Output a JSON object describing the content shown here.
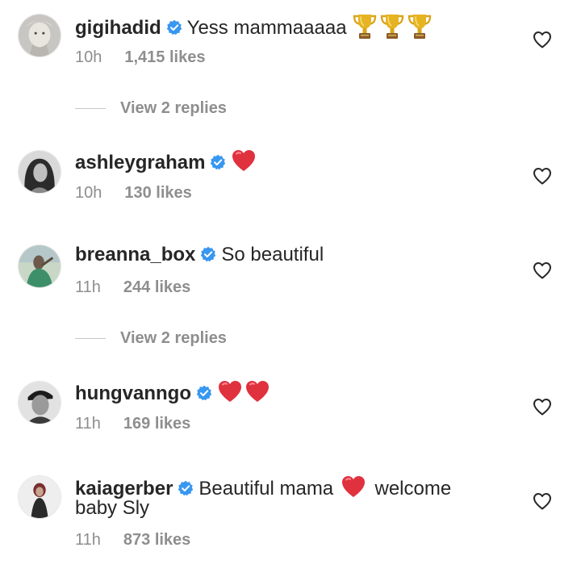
{
  "colors": {
    "text": "#262626",
    "muted": "#8e8e8e",
    "verified": "#3897f0",
    "heart_red": "#ed4956"
  },
  "comments": [
    {
      "username": "gigihadid",
      "verified": true,
      "text": "Yess mammaaaaa",
      "emojis": [
        "trophy",
        "trophy",
        "trophy"
      ],
      "time": "10h",
      "likes": "1,415 likes",
      "replies_label": "View 2 replies"
    },
    {
      "username": "ashleygraham",
      "verified": true,
      "text": "",
      "emojis": [
        "red-heart"
      ],
      "time": "10h",
      "likes": "130 likes"
    },
    {
      "username": "breanna_box",
      "verified": true,
      "text": "So beautiful",
      "time": "11h",
      "likes": "244 likes",
      "replies_label": "View 2 replies"
    },
    {
      "username": "hungvanngo",
      "verified": true,
      "text": "",
      "emojis": [
        "red-heart",
        "red-heart"
      ],
      "time": "11h",
      "likes": "169 likes"
    },
    {
      "username": "kaiagerber",
      "verified": true,
      "text": "Beautiful mama",
      "text_after_emoji": "welcome",
      "text_line2": "baby Sly",
      "emojis": [
        "red-heart"
      ],
      "time": "11h",
      "likes": "873 likes"
    }
  ]
}
